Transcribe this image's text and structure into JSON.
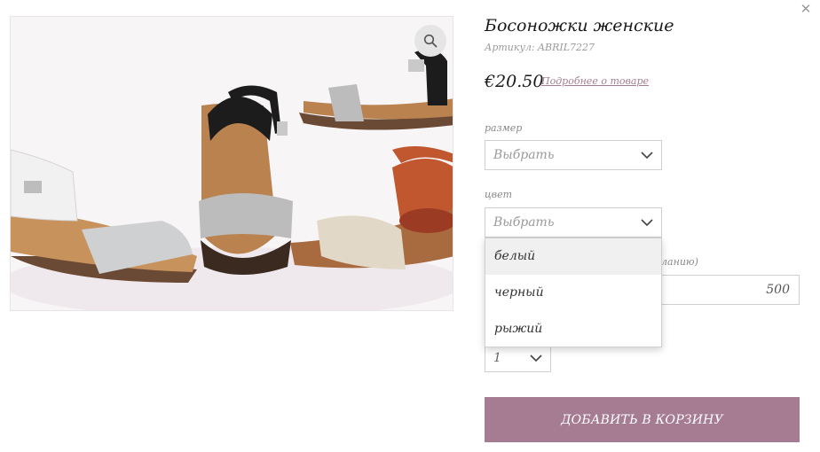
{
  "product": {
    "title": "Босоножки женские",
    "sku": "Артикул: ABRIL7227",
    "price": "€20.50",
    "more_link": "Подробнее о товаре"
  },
  "size_field": {
    "label": "размер",
    "value": "Выбрать"
  },
  "color_field": {
    "label": "цвет",
    "value": "Выбрать",
    "options": [
      "белый",
      "черный",
      "рыжий"
    ],
    "hovered_option": "белый"
  },
  "amount_field": {
    "label_visible": "желанию)",
    "value": "500"
  },
  "quantity": {
    "value": "1"
  },
  "add_to_cart": "ДОБАВИТЬ В КОРЗИНУ",
  "icons": {
    "close": "close-icon",
    "zoom": "zoom-icon",
    "chevron": "chevron-down-icon"
  },
  "colors": {
    "accent": "#a67c92",
    "border": "#cfcfcf",
    "placeholder": "#9a9a9a"
  }
}
